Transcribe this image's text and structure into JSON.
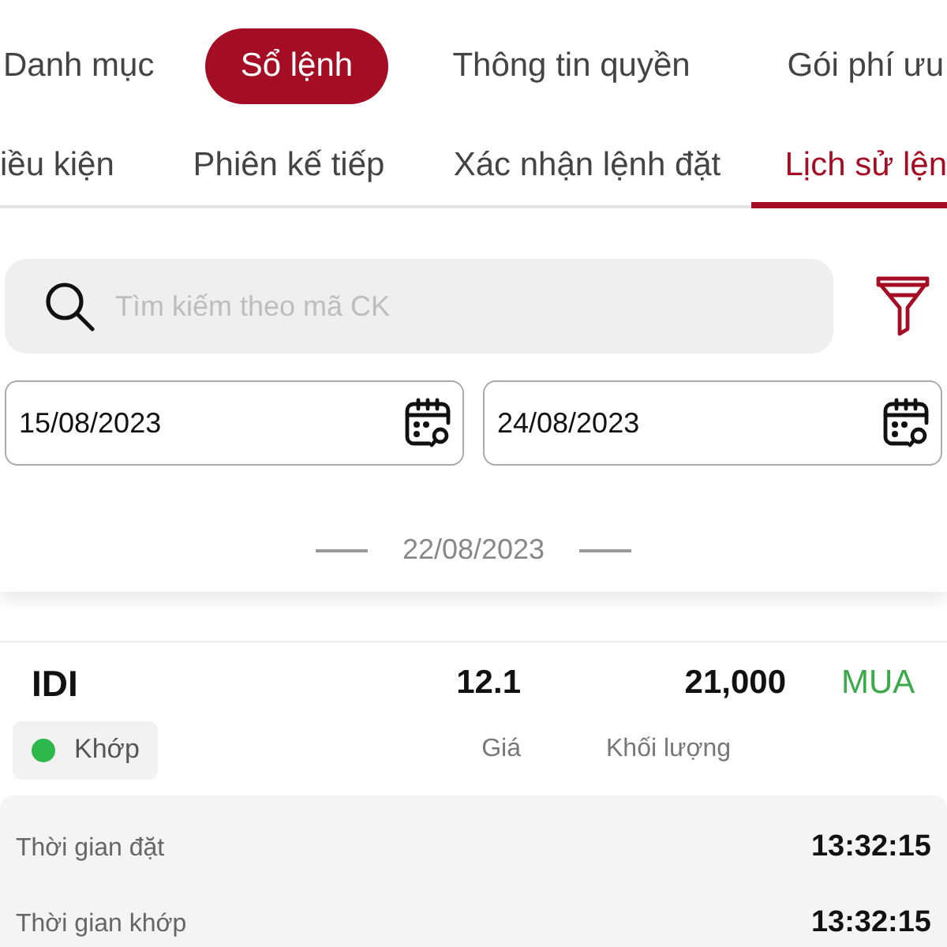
{
  "main_tabs": [
    {
      "label": "Danh mục",
      "selected": false
    },
    {
      "label": "Sổ lệnh",
      "selected": true
    },
    {
      "label": "Thông tin quyền",
      "selected": false
    },
    {
      "label": "Gói phí ưu",
      "selected": false
    }
  ],
  "sub_tabs": [
    {
      "label": "iều kiện",
      "selected": false
    },
    {
      "label": "Phiên kế tiếp",
      "selected": false
    },
    {
      "label": "Xác nhận lệnh đặt",
      "selected": false
    },
    {
      "label": "Lịch sử lện",
      "selected": true
    }
  ],
  "search": {
    "placeholder": "Tìm kiếm theo mã CK"
  },
  "date_range": [
    {
      "value": "15/08/2023"
    },
    {
      "value": "24/08/2023"
    }
  ],
  "date_group": "22/08/2023",
  "orders": [
    {
      "symbol": "IDI",
      "status": {
        "label": "Khớp",
        "color": "#2db84b"
      },
      "price": "12.1",
      "price_label": "Giá",
      "volume": "21,000",
      "volume_label": "Khối lượng",
      "side": {
        "label": "MUA",
        "kind": "buy"
      },
      "details": [
        {
          "label": "Thời gian đặt",
          "value": "13:32:15"
        },
        {
          "label": "Thời gian khớp",
          "value": "13:32:15"
        }
      ]
    }
  ]
}
